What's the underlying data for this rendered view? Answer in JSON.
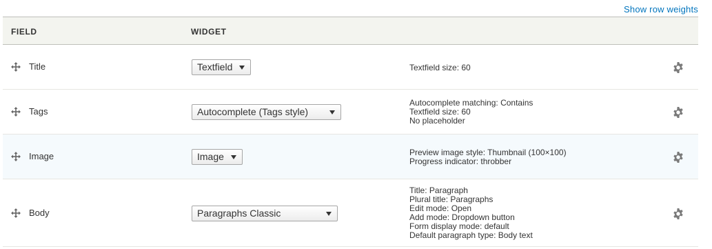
{
  "header": {
    "show_row_weights": "Show row weights",
    "columns": [
      "FIELD",
      "WIDGET"
    ]
  },
  "rows": [
    {
      "field": "Title",
      "widget": "Textfield",
      "summary": [
        "Textfield size: 60"
      ]
    },
    {
      "field": "Tags",
      "widget": "Autocomplete (Tags style)",
      "summary": [
        "Autocomplete matching: Contains",
        "Textfield size: 60",
        "No placeholder"
      ]
    },
    {
      "field": "Image",
      "widget": "Image",
      "summary": [
        "Preview image style: Thumbnail (100×100)",
        "Progress indicator: throbber"
      ]
    },
    {
      "field": "Body",
      "widget": "Paragraphs Classic",
      "summary": [
        "Title: Paragraph",
        "Plural title: Paragraphs",
        "Edit mode: Open",
        "Add mode: Dropdown button",
        "Form display mode: default",
        "Default paragraph type: Body text"
      ]
    }
  ],
  "icons": {
    "drag": "drag-handle-icon",
    "settings": "gear-icon"
  },
  "colors": {
    "link": "#0074bd",
    "header_bg": "#f3f4ef",
    "highlight_row_bg": "#f5fafd"
  }
}
